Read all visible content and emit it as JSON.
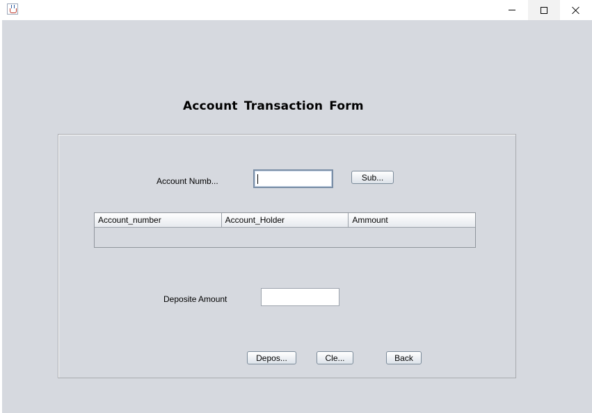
{
  "window": {
    "icon": "java-cup-icon",
    "controls": {
      "minimize": "minimize-icon",
      "maximize": "maximize-icon",
      "close": "close-icon"
    }
  },
  "form": {
    "title": "Account  Transaction  Form",
    "account_number_label": "Account Numb...",
    "account_number_value": "",
    "submit_label": "Sub...",
    "table": {
      "columns": [
        "Account_number",
        "Account_Holder",
        "Ammount"
      ],
      "rows": []
    },
    "deposit_amount_label": "Deposite Amount",
    "deposit_amount_value": "",
    "deposit_label": "Depos...",
    "clear_label": "Cle...",
    "back_label": "Back"
  }
}
